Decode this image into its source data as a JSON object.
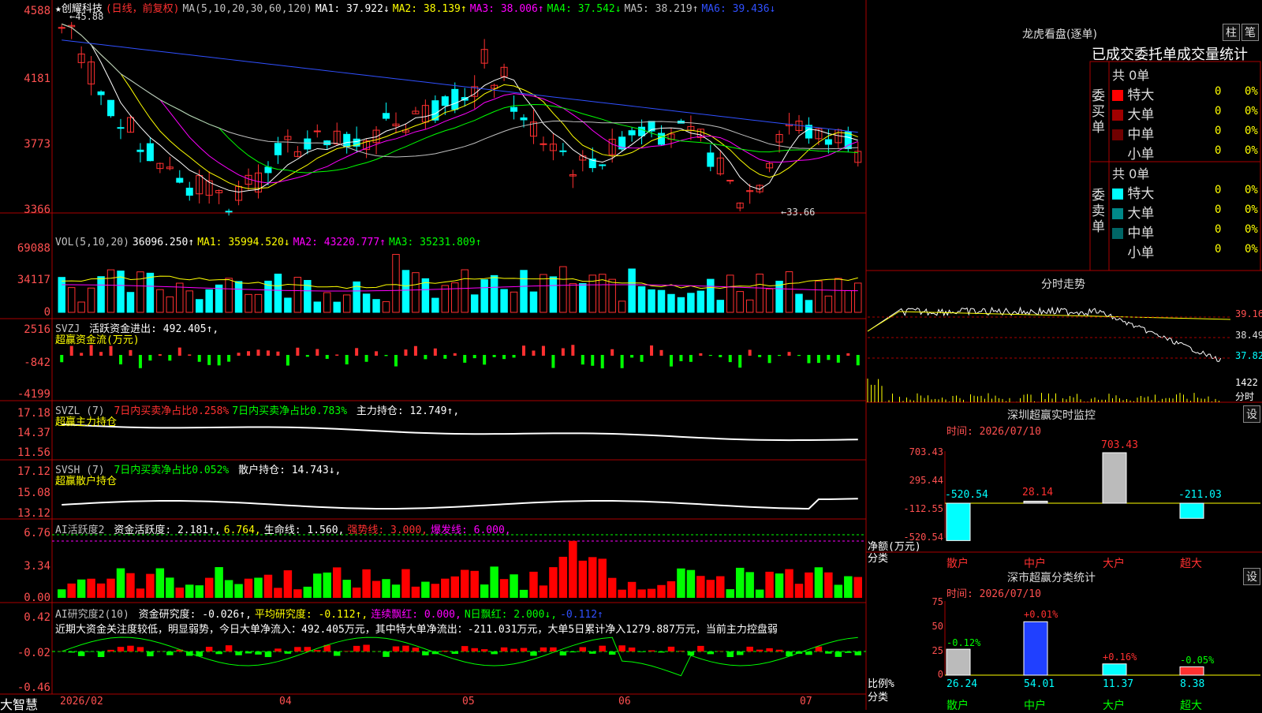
{
  "app": {
    "logo": "大智慧"
  },
  "price": {
    "stock": "★创耀科技",
    "mode": "(日线，前复权)",
    "ma": [
      {
        "label": "MA(5,10,20,30,60,120)",
        "color": "#c0c0c0"
      },
      {
        "label": "MA1: 37.922↓",
        "color": "#ffffff"
      },
      {
        "label": "MA2: 38.139↑",
        "color": "#ffff00"
      },
      {
        "label": "MA3: 38.006↑",
        "color": "#ff00ff"
      },
      {
        "label": "MA4: 37.542↓",
        "color": "#00ff00"
      },
      {
        "label": "MA5: 38.219↑",
        "color": "#c0c0c0"
      },
      {
        "label": "MA6: 39.436↓",
        "color": "#3050ff"
      }
    ],
    "ticks": [
      "4588",
      "4181",
      "3773",
      "3366"
    ],
    "high_label": "45.88",
    "low_label": "33.66"
  },
  "vol": {
    "name": "VOL(5,10,20)",
    "value": "36096.250↑",
    "ma": [
      {
        "label": "MA1: 35994.520↓",
        "color": "#ffff00"
      },
      {
        "label": "MA2: 43220.777↑",
        "color": "#ff00ff"
      },
      {
        "label": "MA3: 35231.809↑",
        "color": "#00ff00"
      }
    ],
    "ticks": [
      "69088",
      "34117",
      "0"
    ]
  },
  "svzj": {
    "name": "SVZJ",
    "line": "活跃资金进出: 492.405↑,",
    "sub": "超赢资金流(万元)",
    "ticks": [
      "2516",
      "-842",
      "-4199"
    ]
  },
  "svzl": {
    "name": "SVZL (7)",
    "a": "7日内买卖净占比0.258%",
    "b": "7日内买卖净占比0.783%",
    "c": "主力持仓: 12.749↑,",
    "sub": "超赢主力持仓",
    "ticks": [
      "17.18",
      "14.37",
      "11.56"
    ]
  },
  "svsh": {
    "name": "SVSH (7)",
    "a": "7日内买卖净占比0.052%",
    "c": "散户持仓: 14.743↓,",
    "sub": "超赢散户持仓",
    "ticks": [
      "17.12",
      "15.08",
      "13.12"
    ]
  },
  "ai1": {
    "name": "AI活跃度2",
    "a": "资金活跃度: 2.181↑,",
    "b": "6.764,",
    "c": "生命线: 1.560,",
    "d": "强势线: 3.000,",
    "e": "爆发线: 6.000,",
    "ticks": [
      "6.76",
      "3.34",
      "0.00"
    ]
  },
  "ai2": {
    "name": "AI研究度2(10)",
    "a": "资金研究度: -0.026↑,",
    "b": "平均研究度: -0.112↑,",
    "c": "连续飘红: 0.000,",
    "d": "N日飘红: 2.000↓,",
    "e": "-0.112↑",
    "note": "近期大资金关注度较低，明显弱势，今日大单净流入：492.405万元，其中特大单净流出：-211.031万元，大单5日累计净入1279.887万元，当前主力控盘弱",
    "ticks": [
      "0.42",
      "-0.02",
      "-0.46"
    ]
  },
  "xaxis": {
    "labels": [
      "2026/02",
      "04",
      "05",
      "06",
      "07"
    ]
  },
  "dragon": {
    "title": "龙虎看盘(逐单)",
    "btn1": "柱",
    "btn2": "笔",
    "tab": "已成交委托单成交量统计",
    "buy": {
      "side": "委买单",
      "total": "共 0单",
      "rows": [
        {
          "label": "特大",
          "count": "0",
          "pct": "0%",
          "color": "#ff0000"
        },
        {
          "label": "大单",
          "count": "0",
          "pct": "0%",
          "color": "#a00000"
        },
        {
          "label": "中单",
          "count": "0",
          "pct": "0%",
          "color": "#700000"
        },
        {
          "label": "小单",
          "count": "0",
          "pct": "0%",
          "color": "#000000"
        }
      ]
    },
    "sell": {
      "side": "委卖单",
      "total": "共 0单",
      "rows": [
        {
          "label": "特大",
          "count": "0",
          "pct": "0%",
          "color": "#00ffff"
        },
        {
          "label": "大单",
          "count": "0",
          "pct": "0%",
          "color": "#008888"
        },
        {
          "label": "中单",
          "count": "0",
          "pct": "0%",
          "color": "#006666"
        },
        {
          "label": "小单",
          "count": "0",
          "pct": "0%",
          "color": "#000000"
        }
      ]
    }
  },
  "intraday": {
    "title": "分时走势",
    "p1": "39.16",
    "p2": "38.49",
    "p3": "37.82",
    "vol": "1422",
    "unit": "分时"
  },
  "monitor": {
    "title": "深圳超赢实时监控",
    "btn": "设",
    "date": "时间: 2026/07/10",
    "ticks": [
      "703.43",
      "295.44",
      "-112.55",
      "-520.54"
    ],
    "ylabel": "净额(万元)",
    "xlabel": "分类",
    "cats": [
      "散户",
      "中户",
      "大户",
      "超大"
    ],
    "vals": [
      -520.54,
      28.14,
      703.43,
      -211.03
    ],
    "labels": [
      "-520.54",
      "28.14",
      "703.43",
      "-211.03"
    ]
  },
  "classify": {
    "title": "深市超赢分类统计",
    "btn": "设",
    "date": "时间: 2026/07/10",
    "ticks": [
      "75",
      "50",
      "25",
      "0"
    ],
    "ylabel": "比例%",
    "xlabel": "分类",
    "cats": [
      "散户",
      "中户",
      "大户",
      "超大"
    ],
    "vals": [
      26.24,
      54.01,
      11.37,
      8.38
    ],
    "changes": [
      "-0.12%",
      "+0.01%",
      "+0.16%",
      "-0.05%"
    ],
    "labels": [
      "26.24",
      "54.01",
      "11.37",
      "8.38"
    ]
  }
}
